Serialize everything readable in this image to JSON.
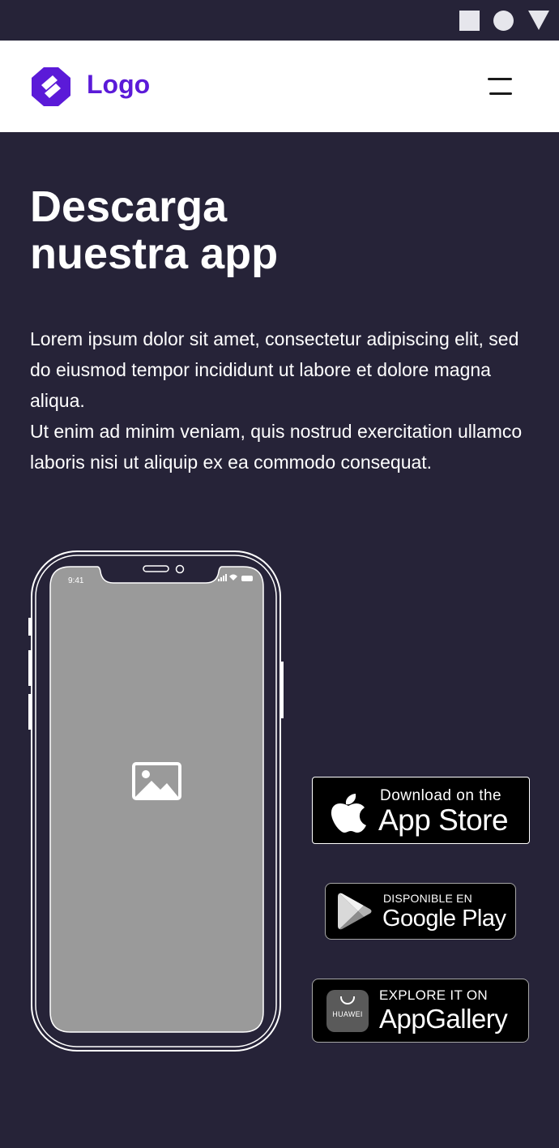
{
  "header": {
    "logo_text": "Logo",
    "brand_color": "#5b1ad8"
  },
  "hero": {
    "title_line1": "Descarga",
    "title_line2": "nuestra app",
    "paragraph1": "Lorem ipsum dolor sit amet, consectetur adipiscing elit, sed do eiusmod tempor incididunt ut labore et dolore magna aliqua.",
    "paragraph2": "Ut enim ad minim veniam, quis nostrud exercitation ullamco laboris nisi ut aliquip ex ea commodo consequat."
  },
  "phone": {
    "time": "9:41",
    "screen_placeholder_icon": "image-icon"
  },
  "badges": {
    "apple": {
      "small": "Download on the",
      "big": "App Store"
    },
    "google": {
      "small": "DISPONIBLE EN",
      "big": "Google Play"
    },
    "huawei": {
      "small": "EXPLORE IT ON",
      "big": "AppGallery",
      "icon_label": "HUAWEI"
    }
  },
  "colors": {
    "background": "#262338",
    "status_icons": "#e6e6ec",
    "phone_screen": "#9a9a9a"
  }
}
